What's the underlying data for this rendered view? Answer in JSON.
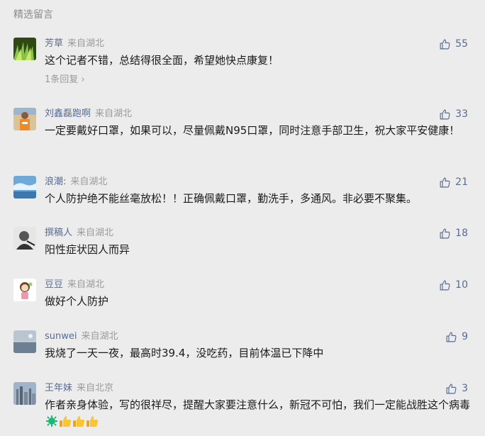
{
  "section_title": "精选留言",
  "comments": [
    {
      "author": "芳草",
      "location": "来自湖北",
      "text": "这个记者不错，总结得很全面，希望她快点康复！",
      "likes": "55",
      "replies": "1条回复",
      "avatar": "grass-avatar"
    },
    {
      "author": "刘鑫磊跑啊",
      "location": "来自湖北",
      "text": "一定要戴好口罩，如果可以，尽量佩戴N95口罩，同时注意手部卫生，祝大家平安健康！",
      "likes": "33",
      "avatar": "runner-avatar"
    },
    {
      "author": "浪潮:",
      "location": "来自湖北",
      "text": "个人防护绝不能丝毫放松！！正确佩戴口罩，勤洗手，多通风。非必要不聚集。",
      "likes": "21",
      "avatar": "sky-avatar"
    },
    {
      "author": "撰稿人",
      "location": "来自湖北",
      "text": "阳性症状因人而异",
      "likes": "18",
      "avatar": "person-avatar"
    },
    {
      "author": "豆豆",
      "location": "来自湖北",
      "text": "做好个人防护",
      "likes": "10",
      "avatar": "cartoon-avatar"
    },
    {
      "author": "sunwei",
      "location": "来自湖北",
      "text": "我烧了一天一夜，最高时39.4，没吃药，目前体温已下降中",
      "likes": "9",
      "avatar": "sea-avatar"
    },
    {
      "author": "王年妹",
      "location": "来自北京",
      "text": "作者亲身体验，写的很祥尽，提醒大家要注意什么，新冠不可怕，我们一定能战胜这个病毒",
      "likes": "3",
      "avatar": "city-avatar",
      "emojis": [
        "virus-emoji",
        "thumbs-up-emoji",
        "thumbs-up-emoji",
        "thumbs-up-emoji"
      ]
    }
  ],
  "colors": {
    "author": "#576b95",
    "meta": "#9a9a9a",
    "background": "#ececec"
  }
}
